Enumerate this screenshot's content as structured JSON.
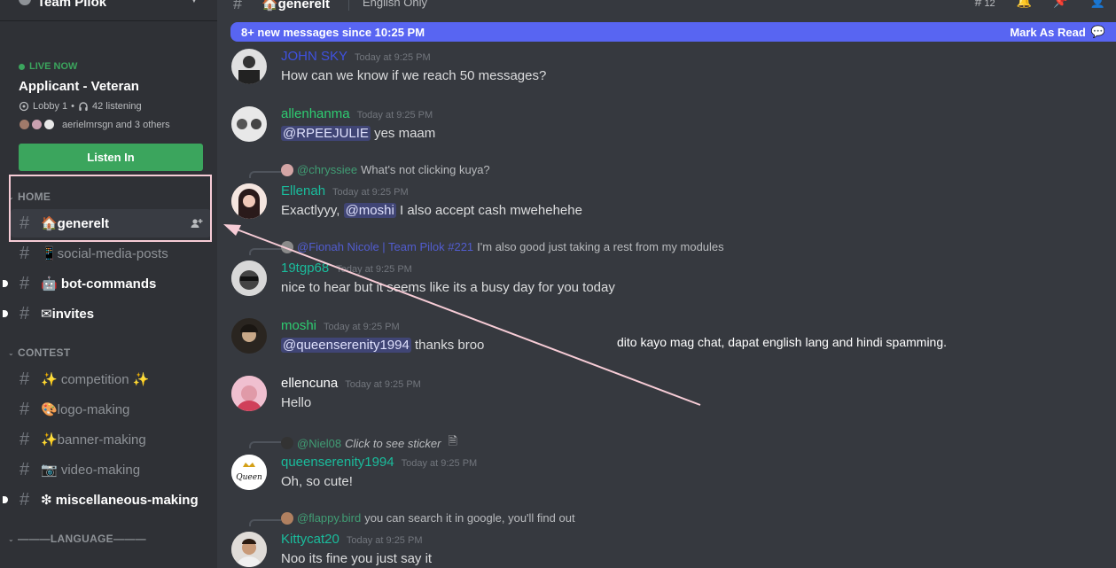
{
  "server": {
    "name": "Team Pilok"
  },
  "live": {
    "status": "LIVE NOW",
    "title": "Applicant - Veteran",
    "stage": "Lobby 1",
    "listening": "42 listening",
    "audience": "aerielmrsgn and 3 others",
    "button": "Listen In"
  },
  "categories": {
    "home": "HOME",
    "contest": "CONTEST",
    "language": "———LANGUAGE———"
  },
  "channels": {
    "generelt": "🏠generelt",
    "social": "📱social-media-posts",
    "bot": "🤖 bot-commands",
    "invites": "✉invites",
    "competition": "✨ competition ✨",
    "logo": "🎨logo-making",
    "banner": "✨banner-making",
    "video": "📷 video-making",
    "misc": "❇ miscellaneous-making"
  },
  "topbar": {
    "channel": "🏠generelt",
    "topic": "English Only",
    "thread_count": "12"
  },
  "banner": {
    "text": "8+ new messages since 10:25 PM",
    "action": "Mark As Read"
  },
  "messages": [
    {
      "user": "JOHN SKY",
      "time": "Today at 9:25 PM",
      "text": "How can we know if we reach 50 messages?"
    },
    {
      "user": "allenhanma",
      "time": "Today at 9:25 PM",
      "mention": "@RPEEJULIE",
      "text": " yes maam"
    },
    {
      "reply_user": "@chryssiee",
      "reply_text": "What's not clicking kuya?",
      "user": "Ellenah",
      "time": "Today at 9:25 PM",
      "pre": "Exactlyyy, ",
      "mention": "@moshi",
      "text": " I also accept cash mwehehehe"
    },
    {
      "reply_user": "@Fionah Nicole | Team Pilok #221",
      "reply_text": "I'm also good just taking a rest from my modules",
      "user": "19tgp68",
      "time": "Today at 9:25 PM",
      "text": "nice to hear but it seems like its a busy day for you today"
    },
    {
      "user": "moshi",
      "time": "Today at 9:25 PM",
      "mention": "@queenserenity1994",
      "text": " thanks broo"
    },
    {
      "user": "ellencuna",
      "time": "Today at 9:25 PM",
      "text": "Hello"
    },
    {
      "reply_user": "@Niel08",
      "reply_text": "Click to see sticker",
      "user": "queenserenity1994",
      "time": "Today at 9:25 PM",
      "text": "Oh, so cute!"
    },
    {
      "reply_user": "@flappy.bird",
      "reply_text": "you can search it in google, you'll find out",
      "user": "Kittycat20",
      "time": "Today at 9:25 PM",
      "text": "Noo its fine you just say it"
    }
  ],
  "annotation": "dito kayo mag chat, dapat english lang and hindi spamming.",
  "colors": {
    "sidebar": "#2f3136",
    "main": "#36393f",
    "live_green": "#3ba55d",
    "banner_blurple": "#5865f2",
    "highlight_pink": "#f7ccd6",
    "name_blue": "#3f51e0",
    "name_green": "#43b581",
    "name_teal": "#1abc9c",
    "name_bright_green": "#2ecc71"
  }
}
